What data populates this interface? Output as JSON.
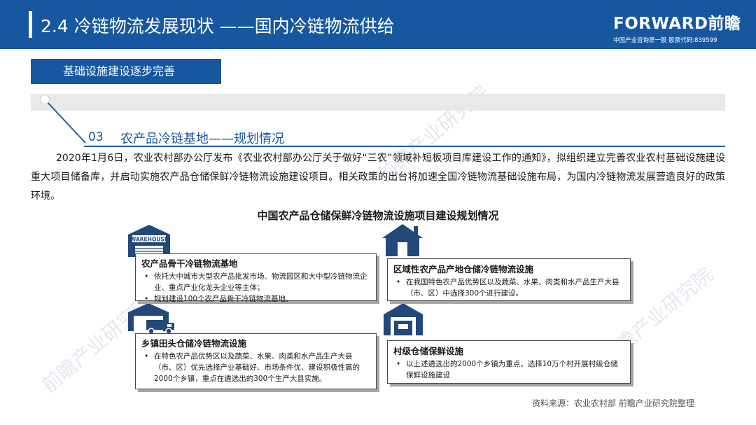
{
  "header": {
    "title": "2.4 冷链物流发展现状 ——国内冷链物流供给",
    "brand_logo": "FORWARD前瞻",
    "brand_tagline": "中国产业咨询第一股 股票代码:839599"
  },
  "section": {
    "tab_label": "基础设施建设逐步完善",
    "sub_number": "03",
    "sub_title": "农产品冷链基地——规划情况"
  },
  "paragraph": "2020年1月6日，农业农村部办公厅发布《农业农村部办公厅关于做好“三农”领域补短板项目库建设工作的通知》，拟组织建立完善农业农村基础设施建设重大项目储备库，并启动实施农产品仓储保鲜冷链物流设施建设项目。相关政策的出台将加速全国冷链物流基础设施布局，为国内冷链物流发展营造良好的政策环境。",
  "chart_title": "中国农产品仓储保鲜冷链物流设施项目建设规划情况",
  "cards": {
    "backbone": {
      "icon_text": "WAREHOUSE",
      "title": "农产品骨干冷链物流基地",
      "bullet": "•",
      "items": [
        "依托大中城市大型农产品批发市场、物流园区和大中型冷链物流企业、重点产业化龙头企业等主体；",
        "规划建设100个农产品骨干冷链物流基地。"
      ]
    },
    "regional": {
      "title": "区域性农产品产地仓储冷链物流设施",
      "bullet": "•",
      "items": [
        "在我国特色农产品优势区以及蔬菜、水果、肉类和水产品生产大县（市、区）中选择300个进行建设。"
      ]
    },
    "township": {
      "title": "乡镇田头仓储冷链物流设施",
      "bullet": "•",
      "items": [
        "在特色农产品优势区以及蔬菜、水果、肉类和水产品生产大县（市、区）优先选择产业基础好、市场条件优、建设积极性高的2000个乡镇，重点在遴选出的300个生产大县实施。"
      ]
    },
    "village": {
      "title": "村级仓储保鲜设施",
      "bullet": "•",
      "items": [
        "以上述遴选出的2000个乡镇为重点，选择10万个村开展村级仓储保鲜设施建设"
      ]
    }
  },
  "footer": {
    "source": "资料来源：农业农村部 前瞻产业研究院整理"
  },
  "watermark": {
    "text": "前瞻产业研究院"
  },
  "colors": {
    "brand_blue": "#17579f",
    "icon_blue": "#23487a",
    "band_gray": "#e9e9e9"
  }
}
